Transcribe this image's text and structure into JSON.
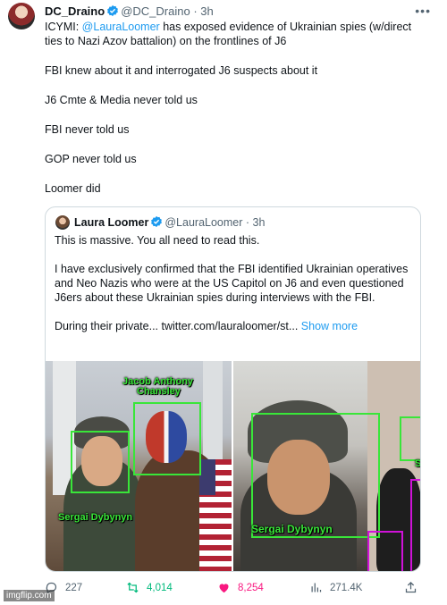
{
  "tweet": {
    "display_name": "DC_Draino",
    "handle": "@DC_Draino",
    "time": "· 3h",
    "more_icon": "more-horizontal-icon",
    "intro_label": "ICYMI: ",
    "mention": "@LauraLoomer",
    "intro_rest": " has exposed evidence of Ukrainian spies (w/direct ties to Nazi Azov battalion) on the frontlines of J6",
    "lines": [
      "FBI knew about it and interrogated J6 suspects about it",
      "J6 Cmte & Media never told us",
      "FBI never told us",
      "GOP never told us",
      "Loomer did"
    ]
  },
  "quote": {
    "display_name": "Laura Loomer",
    "handle": "@LauraLoomer",
    "time": "· 3h",
    "para1": "This is massive. You all need to read this.",
    "para2": "I have exclusively confirmed that the FBI identified Ukrainian operatives and Neo Nazis who were at the US Capitol on J6 and even questioned J6ers about these Ukrainian spies during interviews with the FBI.",
    "para3_start": "During their private...  ",
    "para3_link": "twitter.com/lauraloomer/st...",
    "show_more": " Show more",
    "image_labels": {
      "top_name": "Jacob Anthony",
      "top_name2": "Chansley",
      "left_name": "Sergai Dybynyn",
      "right_name": "Sergai Dybynyn",
      "edge_letter": "S"
    }
  },
  "actions": {
    "replies": "227",
    "retweets": "4,014",
    "likes": "8,254",
    "views": "271.4K"
  },
  "colors": {
    "accent": "#1d9bf0",
    "retweet": "#00ba7c",
    "like": "#f91880",
    "box_green": "#39e639",
    "box_magenta": "#d012d8"
  },
  "watermark": "imgflip.com"
}
